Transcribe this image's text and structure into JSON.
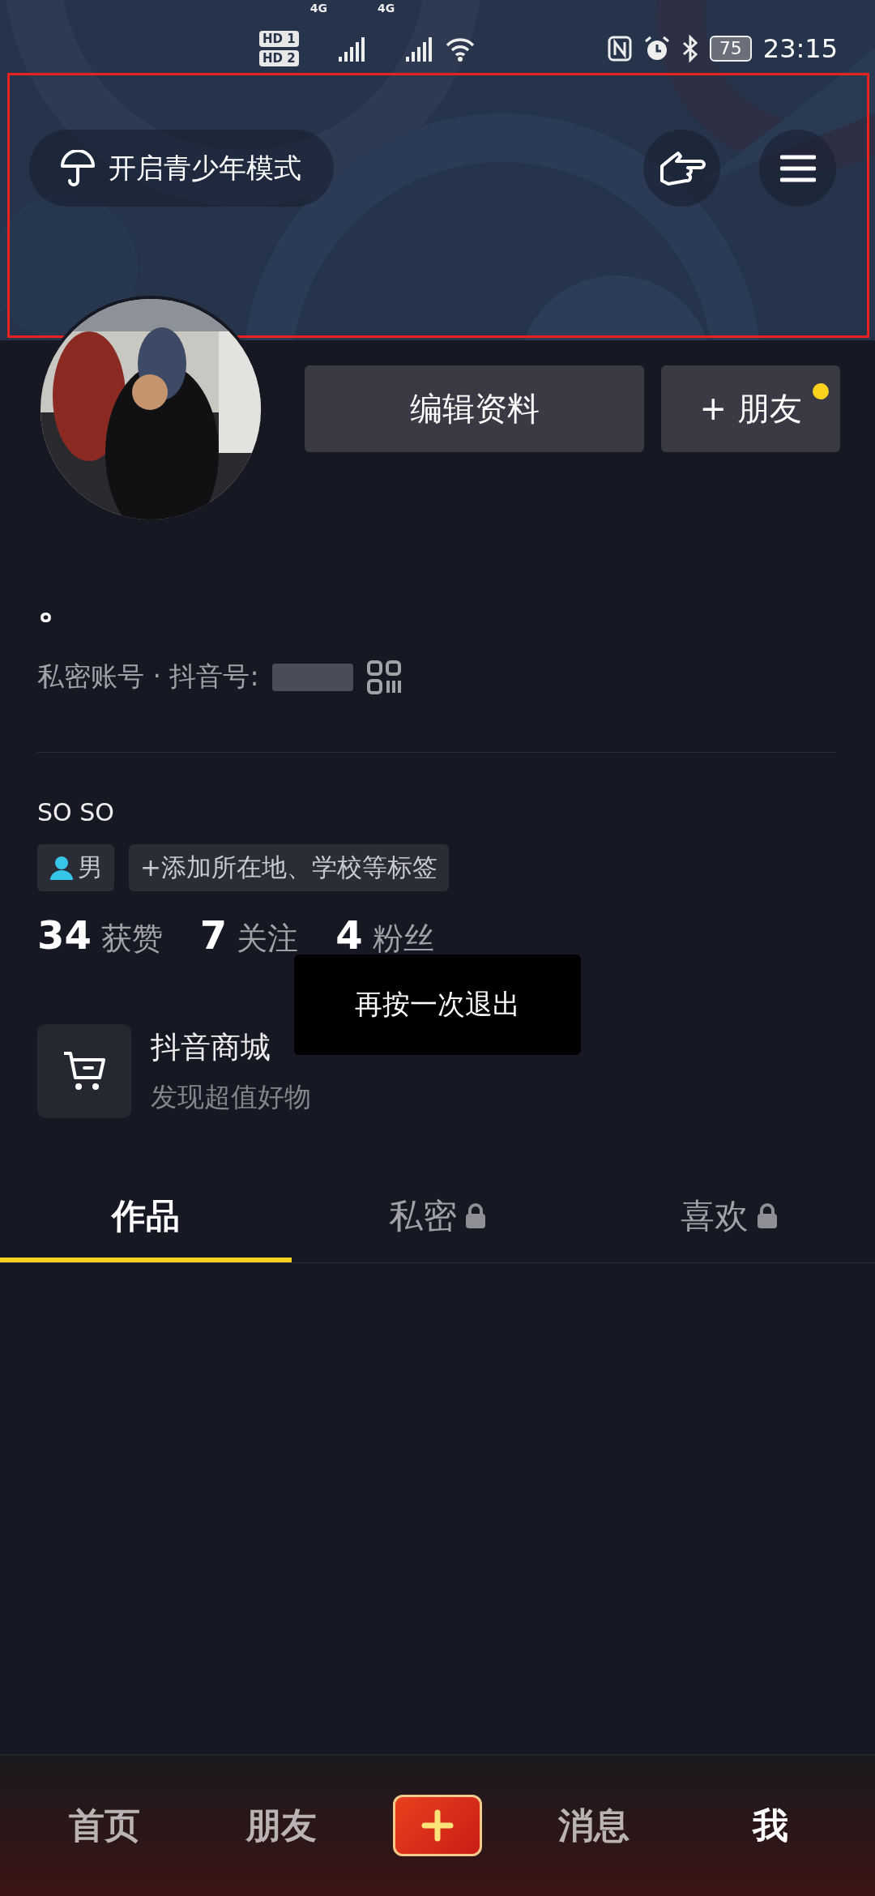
{
  "status_bar": {
    "sim_badges": [
      "HD 1",
      "HD 2"
    ],
    "network": [
      "4G",
      "4G"
    ],
    "battery": "75",
    "time": "23:15"
  },
  "top_bar": {
    "teen_mode": "开启青少年模式"
  },
  "profile": {
    "edit_button": "编辑资料",
    "add_friend_button": "+ 朋友",
    "add_friend_dot": true,
    "name": "。",
    "account_info": "私密账号 · 抖音号:",
    "bio": "SO SO",
    "tags": [
      {
        "kind": "gender",
        "label": "男"
      },
      {
        "kind": "add",
        "label": "+添加所在地、学校等标签"
      }
    ],
    "stats": [
      {
        "count": "34",
        "label": "获赞"
      },
      {
        "count": "7",
        "label": "关注"
      },
      {
        "count": "4",
        "label": "粉丝"
      }
    ]
  },
  "shop": {
    "title": "抖音商城",
    "subtitle": "发现超值好物"
  },
  "tabs": [
    {
      "label": "作品",
      "locked": false,
      "selected": true
    },
    {
      "label": "私密",
      "locked": true,
      "selected": false
    },
    {
      "label": "喜欢",
      "locked": true,
      "selected": false
    }
  ],
  "toast": "再按一次退出",
  "bottom_nav": [
    {
      "kind": "tab",
      "label": "首页",
      "selected": false
    },
    {
      "kind": "tab",
      "label": "朋友",
      "selected": false
    },
    {
      "kind": "create"
    },
    {
      "kind": "tab",
      "label": "消息",
      "selected": false
    },
    {
      "kind": "tab",
      "label": "我",
      "selected": true
    }
  ]
}
